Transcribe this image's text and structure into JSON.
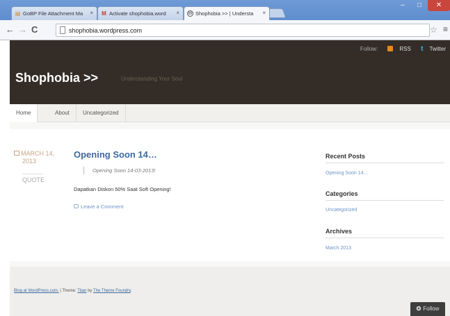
{
  "browser": {
    "tabs": [
      {
        "label": "GoBP File Attachment Ma",
        "icon": "file-icon",
        "active": false
      },
      {
        "label": "Activate shophobia.word",
        "icon": "gmail-icon",
        "active": false
      },
      {
        "label": "Shophobia >> | Understa",
        "icon": "wordpress-icon",
        "active": true
      }
    ],
    "close_glyph": "×",
    "url": "shophobia.wordpress.com",
    "win_min": "–",
    "win_max": "□",
    "win_close": "✕"
  },
  "site": {
    "follow_label": "Follow:",
    "rss_label": "RSS",
    "twitter_label": "Twitter",
    "title": "Shophobia >>",
    "description": "Understanding Your Soul"
  },
  "nav": {
    "items": [
      {
        "label": "Home"
      },
      {
        "label": "About"
      },
      {
        "label": "Uncategorized"
      }
    ]
  },
  "post": {
    "date_line1": "MARCH 14,",
    "date_line2": "2013",
    "category": "QUOTE",
    "title": "Opening Soon 14…",
    "quote": "Opening Soon 14-03-2013!",
    "excerpt": "Dapatkan Diskon 50% Saat Soft Opening!",
    "comment_link": "Leave a Comment"
  },
  "sidebar": {
    "recent_posts_title": "Recent Posts",
    "recent_post_1": "Opening Soon 14…",
    "categories_title": "Categories",
    "category_1": "Uncategorized",
    "archives_title": "Archives",
    "archive_1": "March 2013"
  },
  "footer": {
    "blog_link": "Blog at WordPress.com.",
    "theme_prefix": "| Theme:",
    "theme_name": "Titan",
    "by_text": "by",
    "theme_author": "The Theme Foundry",
    "theme_suffix": "."
  },
  "follow_button": {
    "label": "Follow"
  },
  "colors": {
    "header_bg": "#342d27",
    "link": "#3b6aa0",
    "date": "#c6a385"
  }
}
